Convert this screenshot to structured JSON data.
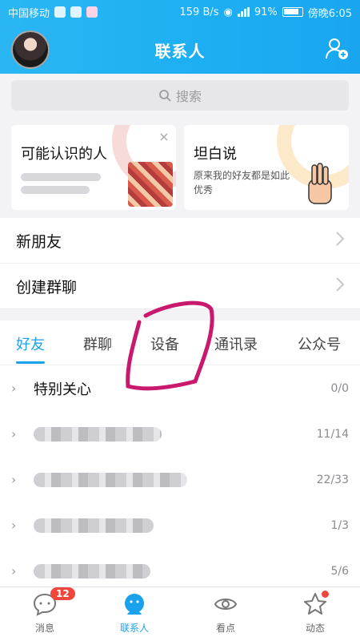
{
  "status_bar": {
    "carrier": "中国移动",
    "speed": "159 B/s",
    "battery": "91%",
    "time": "傍晚6:05"
  },
  "header": {
    "title": "联系人"
  },
  "search": {
    "placeholder": "搜索"
  },
  "cards": [
    {
      "title": "可能认识的人",
      "close": "×"
    },
    {
      "title": "坦白说",
      "subtitle": "原来我的好友都是如此优秀"
    }
  ],
  "rows": [
    {
      "label": "新朋友"
    },
    {
      "label": "创建群聊"
    }
  ],
  "tabs": [
    {
      "label": "好友",
      "active": true
    },
    {
      "label": "群聊"
    },
    {
      "label": "设备"
    },
    {
      "label": "通讯录"
    },
    {
      "label": "公众号"
    }
  ],
  "groups": [
    {
      "name": "特别关心",
      "count": "0/0"
    },
    {
      "name": "",
      "count": "11/14"
    },
    {
      "name": "",
      "count": "22/33"
    },
    {
      "name": "",
      "count": "1/3"
    },
    {
      "name": "",
      "count": "5/6"
    }
  ],
  "bottom_nav": [
    {
      "label": "消息",
      "badge": "12"
    },
    {
      "label": "联系人",
      "active": true
    },
    {
      "label": "看点"
    },
    {
      "label": "动态"
    }
  ],
  "colors": {
    "accent": "#1aa2ec",
    "header": "#1eb0f3",
    "badge": "#f0463c",
    "annotation": "#c8196e"
  }
}
